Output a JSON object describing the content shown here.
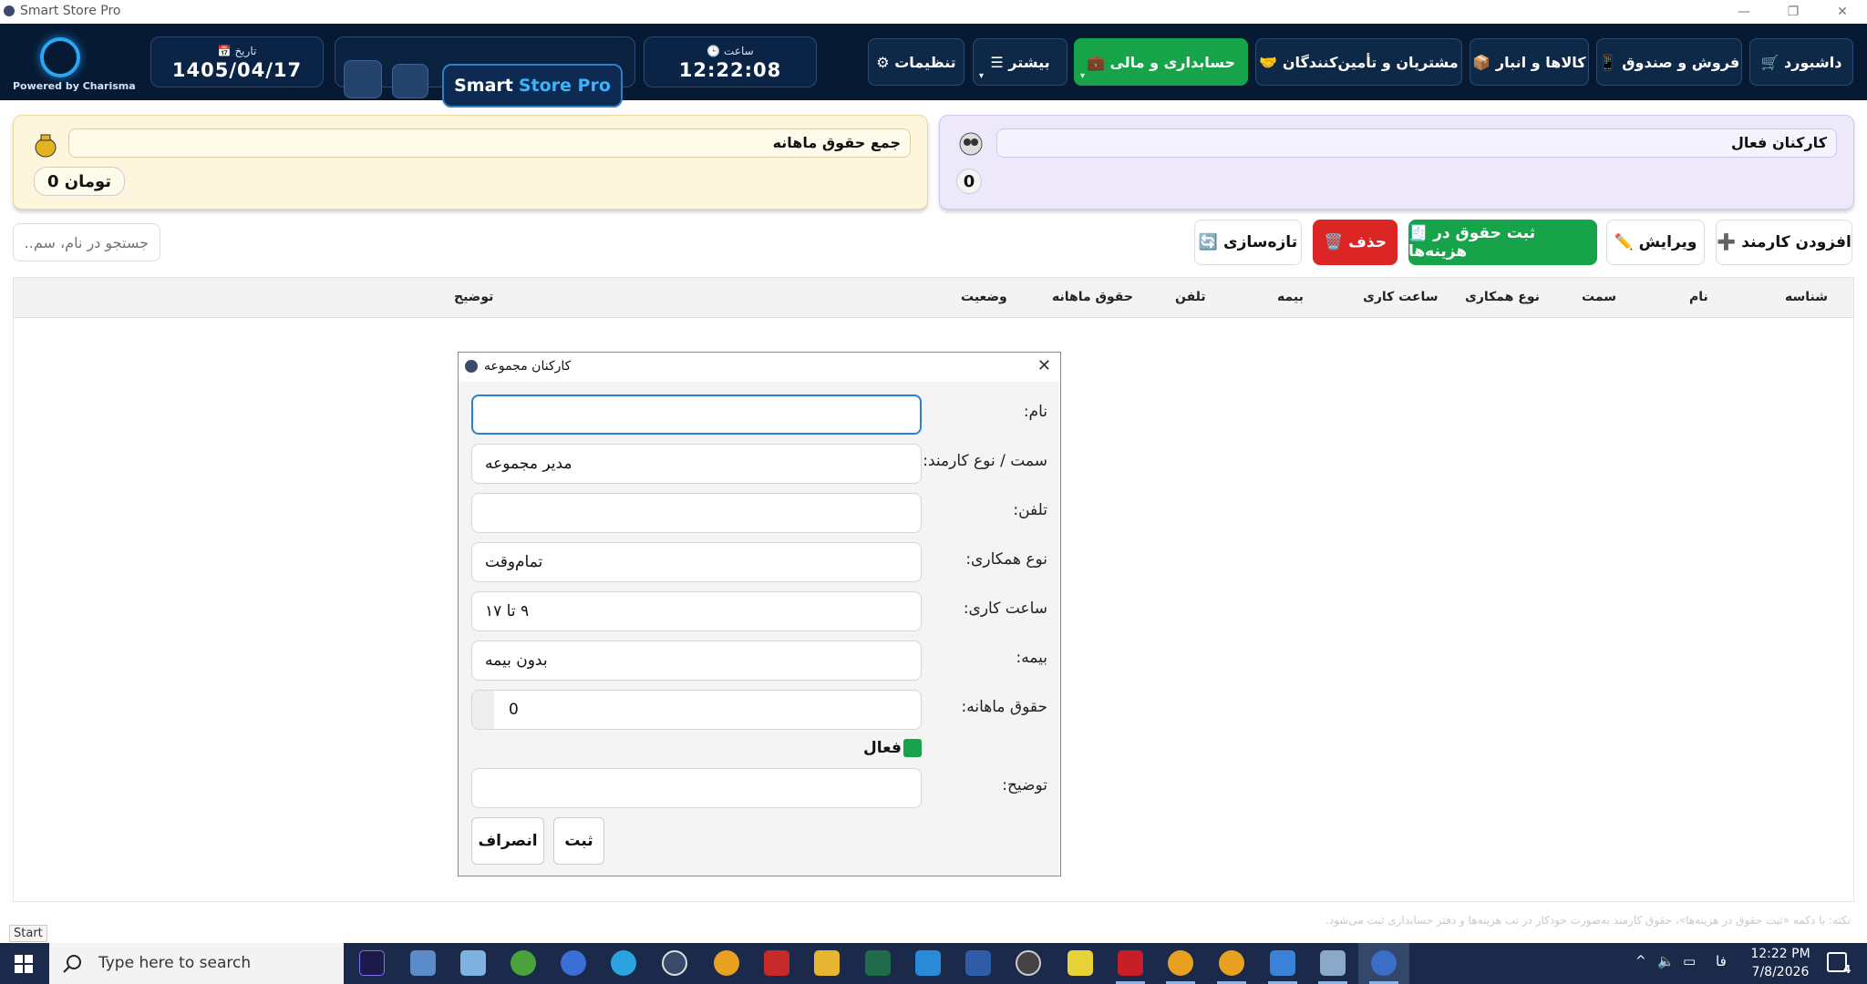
{
  "window": {
    "title": "Smart Store Pro",
    "min": "—",
    "max": "❐",
    "close": "✕"
  },
  "header": {
    "powered": "Powered by Charisma",
    "date_label": "📅 تاریخ",
    "date_value": "1405/04/17",
    "brand_part1": "Smart",
    "brand_part2": "Store Pro",
    "time_label": "🕒 ساعت",
    "time_value": "12:22:08"
  },
  "nav": {
    "dashboard": "🛒 داشبورد",
    "sales": "📱 فروش و صندوق",
    "goods": "📦 کالاها و انبار",
    "customers": "🤝 مشتریان و تأمین‌کنندگان",
    "accounting": "💼 حسابداری و مالی",
    "more": "☰ بیشتر",
    "settings": "⚙ تنظیمات",
    "caret": "▾"
  },
  "summary": {
    "active_staff_label": "کارکنان فعال",
    "active_staff_value": "0",
    "total_salary_label": "جمع حقوق ماهانه",
    "total_salary_value": "0 تومان"
  },
  "toolbar": {
    "add": "➕ افزودن کارمند",
    "edit": "✏️ ویرایش",
    "register_salary": "🧾 ثبت حقوق در هزینه‌ها",
    "delete": "🗑️ حذف",
    "refresh": "🔄 تازه‌سازی",
    "search_placeholder": "جستجو در نام، سم..."
  },
  "table": {
    "columns": [
      "شناسه",
      "نام",
      "سمت",
      "نوع همکاری",
      "ساعت کاری",
      "بیمه",
      "تلفن",
      "حقوق ماهانه",
      "وضعیت",
      "توضیح"
    ]
  },
  "dialog": {
    "title": "کارکنان مجموعه",
    "close": "✕",
    "name_label": "نام:",
    "name_value": "",
    "role_label": "سمت / نوع کارمند:",
    "role_value": "مدیر مجموعه",
    "phone_label": "تلفن:",
    "phone_value": "",
    "type_label": "نوع همکاری:",
    "type_value": "تمام‌وقت",
    "hours_label": "ساعت کاری:",
    "hours_value": "۹ تا ۱۷",
    "insurance_label": "بیمه:",
    "insurance_value": "بدون بیمه",
    "salary_label": "حقوق ماهانه:",
    "salary_value": "0",
    "active_label": "فعال",
    "desc_label": "توضیح:",
    "desc_value": "",
    "submit": "ثبت",
    "cancel": "انصراف"
  },
  "footer": {
    "start": "Start",
    "note": "نکته: با دکمه «ثبت حقوق در هزینه‌ها»، حقوق کارمند به‌صورت خودکار در تب هزینه‌ها و دفتر حسابداری ثبت می‌شود."
  },
  "taskbar": {
    "search_placeholder": "Type here to search",
    "lang": "فا",
    "time": "12:22 PM",
    "date": "7/8/2026",
    "notif_count": "4"
  },
  "colors": {
    "topbar": "#061a33",
    "accent_green": "#16a34a",
    "danger": "#dc2626",
    "yellow_card": "#fdf6dc",
    "purple_card": "#ede9fb"
  }
}
